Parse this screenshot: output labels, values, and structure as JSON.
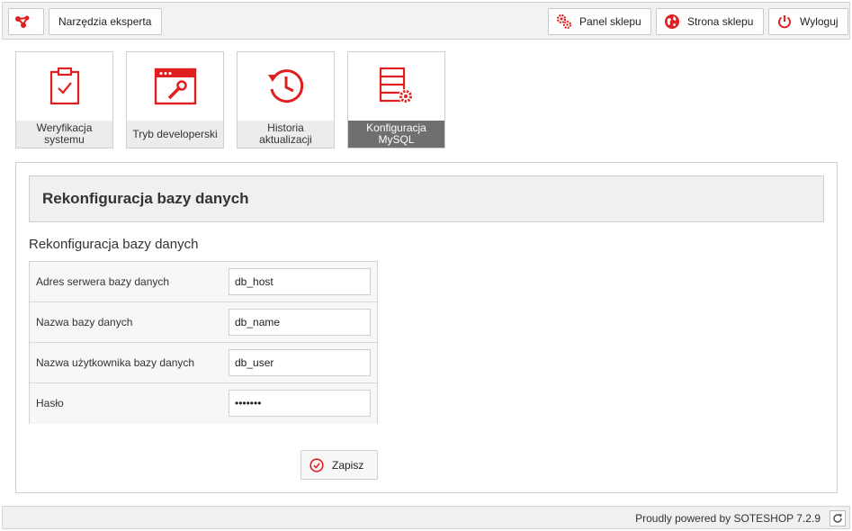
{
  "colors": {
    "accent": "#e02020",
    "active_tile": "#6f6f6f"
  },
  "topbar": {
    "logo_icon": "share-nodes-icon",
    "tools_label": "Narzędzia eksperta",
    "panel_label": "Panel sklepu",
    "panel_icon": "gears-icon",
    "shop_label": "Strona sklepu",
    "shop_icon": "globe-icon",
    "logout_label": "Wyloguj",
    "logout_icon": "power-icon"
  },
  "tiles": [
    {
      "label": "Weryfikacja systemu",
      "icon": "clipboard-check-icon",
      "active": false
    },
    {
      "label": "Tryb developerski",
      "icon": "browser-wrench-icon",
      "active": false
    },
    {
      "label": "Historia aktualizacji",
      "icon": "history-clock-icon",
      "active": false
    },
    {
      "label": "Konfiguracja MySQL",
      "icon": "database-settings-icon",
      "active": true
    }
  ],
  "panel": {
    "heading": "Rekonfiguracja bazy danych",
    "section_title": "Rekonfiguracja bazy danych",
    "fields": [
      {
        "label": "Adres serwera bazy danych",
        "value": "db_host",
        "type": "text"
      },
      {
        "label": "Nazwa bazy danych",
        "value": "db_name",
        "type": "text"
      },
      {
        "label": "Nazwa użytkownika bazy danych",
        "value": "db_user",
        "type": "text"
      },
      {
        "label": "Hasło",
        "value": "•••••••",
        "type": "password"
      }
    ],
    "save_label": "Zapisz",
    "save_icon": "check-circle-icon"
  },
  "footer": {
    "text": "Proudly powered by SOTESHOP 7.2.9",
    "refresh_icon": "refresh-icon"
  }
}
